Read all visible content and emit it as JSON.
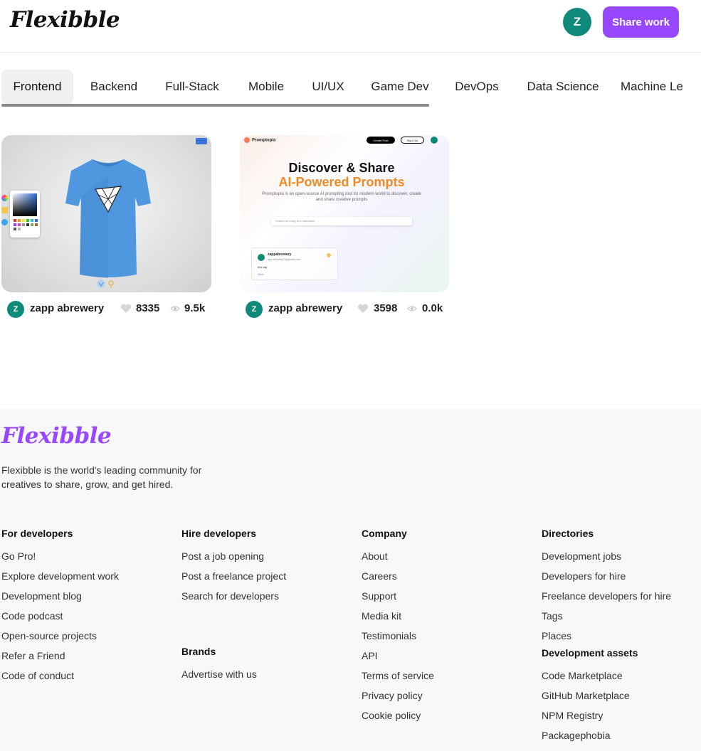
{
  "header": {
    "logo": "Flexibble",
    "avatar_initial": "Z",
    "share_label": "Share work"
  },
  "tabs": [
    {
      "label": "Frontend",
      "active": true
    },
    {
      "label": "Backend"
    },
    {
      "label": "Full-Stack"
    },
    {
      "label": "Mobile"
    },
    {
      "label": "UI/UX"
    },
    {
      "label": "Game Dev"
    },
    {
      "label": "DevOps"
    },
    {
      "label": "Data Science"
    },
    {
      "label": "Machine Le"
    }
  ],
  "projects": [
    {
      "author_initial": "Z",
      "author": "zapp abrewery",
      "likes": "8335",
      "views": "9.5k",
      "thumbnail": "tshirt-customizer"
    },
    {
      "author_initial": "Z",
      "author": "zapp abrewery",
      "likes": "3598",
      "views": "0.0k",
      "thumbnail": "promptopia",
      "preview": {
        "brand": "Promptopia",
        "create_label": "Create Post",
        "signout_label": "Sign Out",
        "headline": "Discover & Share",
        "headline_accent": "AI-Powered Prompts",
        "description": "Promptopia is an open-source AI prompting tool for modern world to discover, create and share creative prompts",
        "search_placeholder": "Search for a tag or a username",
        "post_user": "zappabrewery",
        "post_email": "app.brewery?@gmail.com",
        "post_text": "test tag",
        "post_tag": "#test"
      }
    }
  ],
  "footer": {
    "logo": "Flexibble",
    "tagline": "Flexibble is the world's leading community for creatives to share, grow, and get hired.",
    "columns": [
      {
        "heading": "For developers",
        "links": [
          "Go Pro!",
          "Explore development work",
          "Development blog",
          "Code podcast",
          "Open-source projects",
          "Refer a Friend",
          "Code of conduct"
        ]
      },
      {
        "heading": "Hire developers",
        "links": [
          "Post a job opening",
          "Post a freelance project",
          "Search for developers"
        ],
        "sub_heading": "Brands",
        "sub_links": [
          "Advertise with us"
        ]
      },
      {
        "heading": "Company",
        "links": [
          "About",
          "Careers",
          "Support",
          "Media kit",
          "Testimonials",
          "API",
          "Terms of service",
          "Privacy policy",
          "Cookie policy"
        ]
      },
      {
        "heading": "Directories",
        "links": [
          "Development jobs",
          "Developers for hire",
          "Freelance developers for hire",
          "Tags",
          "Places"
        ],
        "sub_heading": "Development assets",
        "sub_links": [
          "Code Marketplace",
          "GitHub Marketplace",
          "NPM Registry",
          "Packagephobia"
        ]
      }
    ]
  },
  "colors": {
    "brand_purple": "#9747ff",
    "avatar_teal": "#0f8a7a"
  }
}
